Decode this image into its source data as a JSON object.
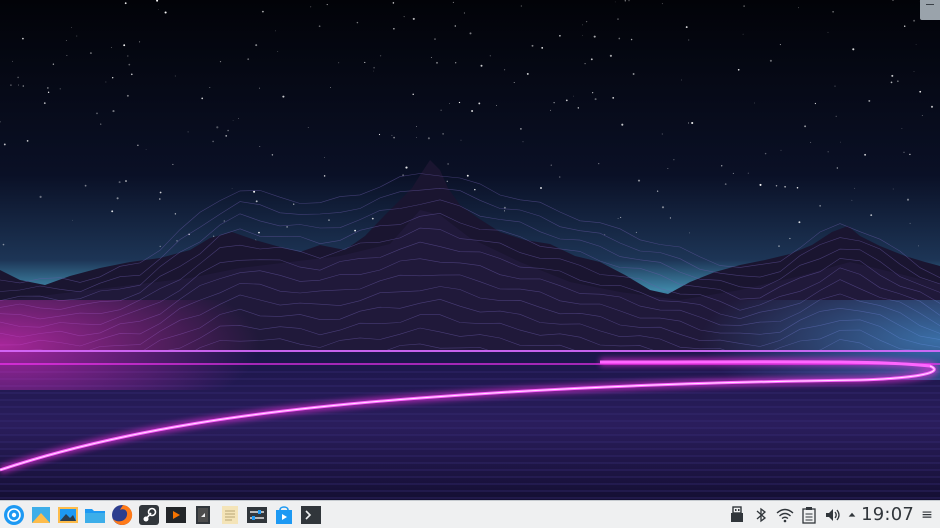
{
  "desktop": {
    "wallpaper": "synthwave-mountains"
  },
  "colors": {
    "sky_top": "#03040d",
    "sky_horizon": "#3f87a8",
    "mountain": "#1a1530",
    "neon": "#ff33ff",
    "panel_bg": "#eff0f1",
    "panel_text": "#31363b"
  },
  "panel": {
    "launcher_icon": "application-launcher-icon",
    "tasks": [
      {
        "name": "kate-editor-icon"
      },
      {
        "name": "image-viewer-icon"
      },
      {
        "name": "file-manager-icon"
      },
      {
        "name": "firefox-icon"
      },
      {
        "name": "steam-icon"
      },
      {
        "name": "media-player-icon"
      },
      {
        "name": "document-viewer-icon"
      },
      {
        "name": "notes-icon"
      },
      {
        "name": "system-settings-icon"
      },
      {
        "name": "discover-store-icon"
      },
      {
        "name": "terminal-icon"
      }
    ],
    "tray": {
      "icons": [
        "usb-device-icon",
        "bluetooth-icon",
        "wifi-icon",
        "clipboard-icon",
        "volume-icon",
        "expand-arrow-icon"
      ],
      "clock": "19:07",
      "menu_glyph": "≡"
    }
  }
}
